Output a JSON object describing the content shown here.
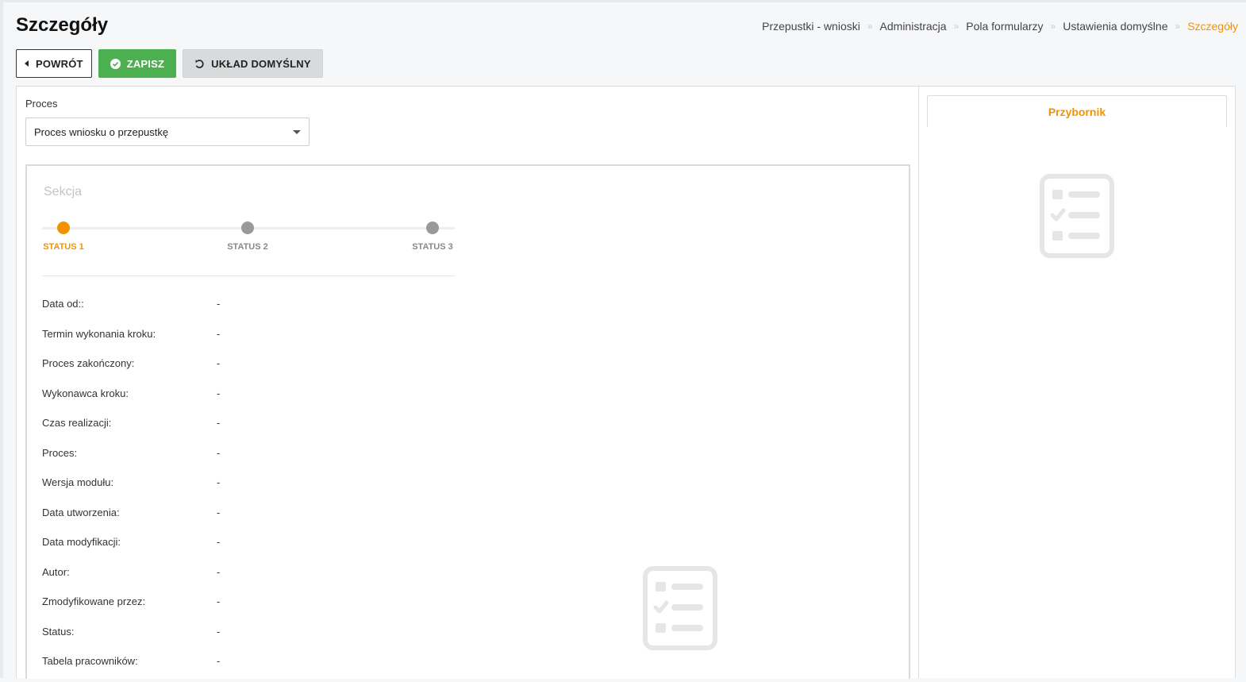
{
  "page": {
    "title": "Szczegóły"
  },
  "breadcrumb": {
    "items": [
      "Przepustki - wnioski",
      "Administracja",
      "Pola formularzy",
      "Ustawienia domyślne"
    ],
    "current": "Szczegóły",
    "separator": "»"
  },
  "toolbar": {
    "back_label": "POWRÓT",
    "save_label": "ZAPISZ",
    "default_layout_label": "UKŁAD DOMYŚLNY"
  },
  "process": {
    "label": "Proces",
    "selected": "Proces wniosku o przepustkę"
  },
  "section": {
    "title": "Sekcja",
    "steps": [
      "STATUS 1",
      "STATUS 2",
      "STATUS 3"
    ],
    "active_step": 0
  },
  "fields": [
    {
      "label": "Data od::",
      "value": "-"
    },
    {
      "label": "Termin wykonania kroku:",
      "value": "-"
    },
    {
      "label": "Proces zakończony:",
      "value": "-"
    },
    {
      "label": "Wykonawca kroku:",
      "value": "-"
    },
    {
      "label": "Czas realizacji:",
      "value": "-"
    },
    {
      "label": "Proces:",
      "value": "-"
    },
    {
      "label": "Wersja modułu:",
      "value": "-"
    },
    {
      "label": "Data utworzenia:",
      "value": "-"
    },
    {
      "label": "Data modyfikacji:",
      "value": "-"
    },
    {
      "label": "Autor:",
      "value": "-"
    },
    {
      "label": "Zmodyfikowane przez:",
      "value": "-"
    },
    {
      "label": "Status:",
      "value": "-"
    },
    {
      "label": "Tabela pracowników:",
      "value": "-"
    }
  ],
  "sidebar": {
    "tab_label": "Przybornik"
  },
  "icons": {
    "back": "caret-left-icon",
    "save": "check-circle-icon",
    "default_layout": "undo-icon",
    "placeholder": "checklist-icon"
  },
  "colors": {
    "accent": "#f39200",
    "save_button": "#4caf50",
    "inactive_step": "#999999",
    "placeholder_icon": "#e3e3e3"
  }
}
